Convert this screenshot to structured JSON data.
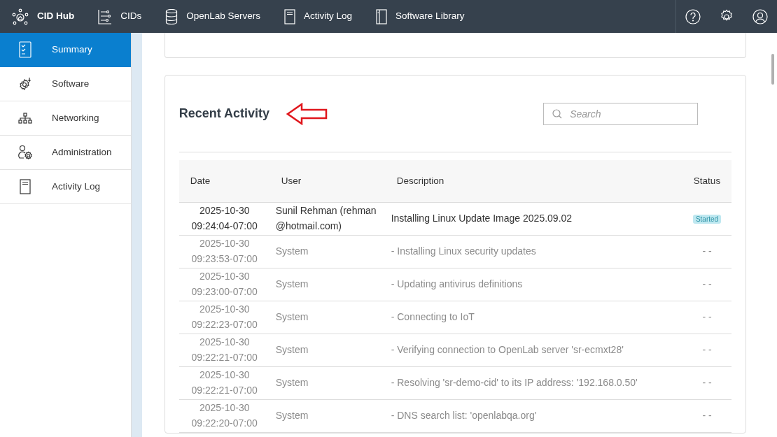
{
  "brand": {
    "title": "CID Hub"
  },
  "nav": [
    {
      "label": "CIDs"
    },
    {
      "label": "OpenLab Servers"
    },
    {
      "label": "Activity Log"
    },
    {
      "label": "Software Library"
    }
  ],
  "sidebar": {
    "items": [
      {
        "label": "Summary",
        "selected": true
      },
      {
        "label": "Software",
        "selected": false
      },
      {
        "label": "Networking",
        "selected": false
      },
      {
        "label": "Administration",
        "selected": false
      },
      {
        "label": "Activity Log",
        "selected": false
      }
    ]
  },
  "recent_activity": {
    "title": "Recent Activity",
    "search": {
      "placeholder": "Search"
    },
    "columns": [
      "Date",
      "User",
      "Description",
      "Status"
    ],
    "rows": [
      {
        "kind": "user",
        "date": "2025-10-30 09:24:04-07:00",
        "user": "Sunil Rehman (rehman@hotmail.com)",
        "description": "Installing Linux Update Image 2025.09.02",
        "status": "Started"
      },
      {
        "kind": "system",
        "date": "2025-10-30 09:23:53-07:00",
        "user": "System",
        "description": "-  Installing Linux security updates",
        "status": "- -"
      },
      {
        "kind": "system",
        "date": "2025-10-30 09:23:00-07:00",
        "user": "System",
        "description": "-  Updating antivirus definitions",
        "status": "- -"
      },
      {
        "kind": "system",
        "date": "2025-10-30 09:22:23-07:00",
        "user": "System",
        "description": "-  Connecting to IoT",
        "status": "- -"
      },
      {
        "kind": "system",
        "date": "2025-10-30 09:22:21-07:00",
        "user": "System",
        "description": "-  Verifying connection to OpenLab server 'sr-ecmxt28'",
        "status": "- -"
      },
      {
        "kind": "system",
        "date": "2025-10-30 09:22:21-07:00",
        "user": "System",
        "description": "-  Resolving 'sr-demo-cid' to its IP address: '192.168.0.50'",
        "status": "- -"
      },
      {
        "kind": "system",
        "date": "2025-10-30 09:22:20-07:00",
        "user": "System",
        "description": "-  DNS search list: 'openlabqa.org'",
        "status": "- -"
      }
    ]
  }
}
